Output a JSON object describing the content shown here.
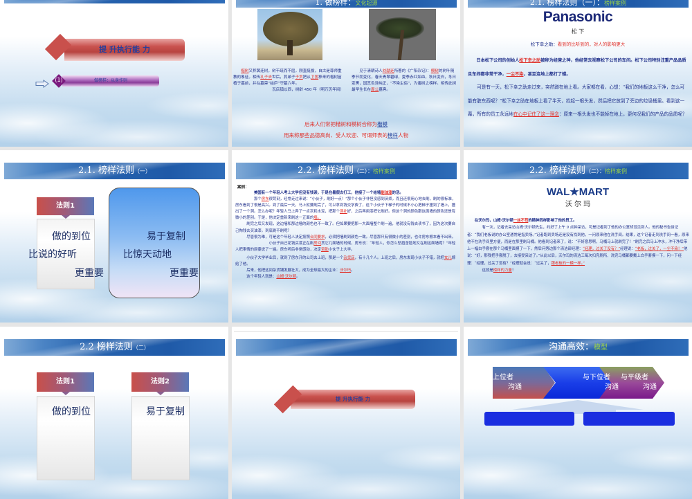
{
  "slides": [
    {
      "title_main": "提 升执行能 力",
      "sub_num": "(1)",
      "sub_label": "做榜样：以身作则"
    },
    {
      "header": "1. 做榜样：",
      "header_sub": "文化起源",
      "left_paragraph": [
        [
          "楷树",
          1
        ],
        [
          "又称黄连树，树干疏而不屈，刚直挺拔，自古是尊师重教的象征。相传",
          0
        ],
        [
          "孔子去",
          1
        ],
        [
          "世后，其弟子",
          0
        ],
        [
          "子贡",
          1
        ],
        [
          "把从",
          0
        ],
        [
          "卫国",
          1
        ],
        [
          "移来的楷树苗植于墓前，并在墓旁“结庐”守墓六年。",
          0
        ]
      ],
      "left_caption": "瓦店镇以西，树龄 450 年（明万历年间）",
      "right_paragraph": [
        [
          "见于清朝诗人",
          0
        ],
        [
          "刘献廷",
          1
        ],
        [
          "所著的《广阳杂记》：",
          0
        ],
        [
          "模树",
          1
        ],
        [
          "的树叶随季节而变化，春天青翠碧绿，夏季赤红如血，秋日变白，冬日变黑，因其色泽纯正，“不染尘俗”，为诸树之榜样。相传此树最早生长在",
          0
        ],
        [
          "周公",
          1
        ],
        [
          "墓旁。",
          0
        ]
      ],
      "conclusion1_a": "后来人们常把楷树和模树合称为",
      "conclusion1_b": "楷模",
      "conclusion2_a": "用来称那些品德高尚、受人欢迎、可谓师表的",
      "conclusion2_b": "榜样",
      "conclusion2_c": "人物"
    },
    {
      "header": "2.1. 榜样法则（一）：",
      "header_sub": "榜样案例",
      "logo": "Panasonic",
      "logo_cn": "松 下",
      "quote_name": "松下幸之助：",
      "quote": "看到的比听到的，对人的影响更大",
      "paragraphs": [
        [
          [
            "日本松下公司的创始人",
            0
          ],
          [
            "松下幸之助",
            1
          ],
          [
            "被称为经营之神，他经常去视察松下公司的车间。松下公司特别注重产品品质且车间都非常干净，",
            0
          ],
          [
            "一尘不染",
            1
          ],
          [
            "，甚至连地上都打了蜡。",
            0
          ]
        ],
        [
          [
            "可是有一天，松下幸之助走过来，突然蹲在地上看。大家都在看，心想：“我们的地板这么干净，怎么可能有脏东西呢？”松下幸之助在地板上看了半天，捡起一根头发，然后把它放到了旁边的垃圾桶里。看到这一幕，所有的员工永远地",
            0
          ],
          [
            "在心中记住了这一理念",
            1
          ],
          [
            "：原来一根头发也不能掉在地上，更何况我们的产品的品质呢？",
            0
          ]
        ]
      ]
    },
    {
      "header": "2.1. 榜样法则",
      "header_small": "（一）",
      "rule_label": "法则1",
      "left_lines": [
        "做的到位",
        "比说的好听",
        "更重要"
      ],
      "right_lines": [
        "易于复制",
        "比惊天动地",
        "更重要"
      ]
    },
    {
      "header": "2.2. 榜样法则",
      "header_small": "（二）：",
      "header_sub": "榜样案例",
      "case_label": "案例：",
      "paragraphs": [
        [
          [
            "美国有一个年轻人考上大学但没有钱读，于是在暑假去打工，他接了一个给墙",
            0
          ],
          [
            "刷油漆",
            1
          ],
          [
            "的活。",
            0
          ]
        ],
        [
          [
            "那个",
            0
          ],
          [
            "房东",
            1
          ],
          [
            "很苛刻，经常走过来说：“小伙子，刷好一点！”那个小伙子非但没感到厌烦，而且还很用心地去刷，刷的很标准，房东看到了很是高兴。到了最后一天，马上就要刷完了，可以拿到钱交学费了，这个小伙子下梯子的时候不小心把梯子撞到了墙上，撞出了一个洞。怎么办呢？年轻人马上弄了一点灰和水泥，把那个",
            0
          ],
          [
            "洞补",
            1
          ],
          [
            "好，之后再用漆把它刷好。但这个洞的颜色跟这面墙的颜色还是有微小的差别。于是，他决定重新来刷这一正面的",
            0
          ],
          [
            "墙。",
            1
          ]
        ],
        [
          [
            "刷完之后又发现，这边墙和那边墙的颜色也不一致了。但如果要把那一大面墙整个刷一遍，他就没有钱去读书了，因为这次要自己掏钱去买油漆。到底刷不刷呢？",
            0
          ]
        ],
        [
          [
            "尽管很为难，可是这个年轻人决定按照",
            0
          ],
          [
            "合同要求",
            1
          ],
          [
            "，必须把墙刷到颜色一致。尽管那只有很微小的差别，也许房东根本看不出来。",
            0
          ]
        ],
        [
          [
            "小伙子自己花钱买漆正在刷",
            0
          ],
          [
            "房间",
            1
          ],
          [
            "其它几面墙的时候，房东说：“年轻人，你怎么愁眉苦脸地又在刷这面墙呢？”年轻人把事情的原委说了一遍。房东听后非常感动，决定",
            0
          ],
          [
            "资助",
            1
          ],
          [
            "小伙子上大学。",
            0
          ]
        ],
        [
          [
            "小伙子大学毕业后，就到了房东开的公司去上班，那是一个",
            0
          ],
          [
            "杂货店",
            1
          ],
          [
            "，有十几个人。上班之后，房东发现小伙子不错，就把",
            0
          ],
          [
            "女儿",
            1
          ],
          [
            "嫁给了他。",
            0
          ]
        ],
        [
          [
            "后来，他把这间杂货铺发展壮大，成为全球最大的企业：",
            0
          ],
          [
            "沃尔玛",
            1
          ],
          [
            "。",
            0
          ]
        ],
        [
          [
            "这个年轻人就是：",
            0
          ],
          [
            "山姆·沃尔顿",
            1
          ],
          [
            "。",
            0
          ]
        ]
      ]
    },
    {
      "header": "2.2. 榜样法则",
      "header_small": "（二）：",
      "header_sub": "榜样案例",
      "logo": "WAL★MART",
      "logo_cn": "沃 尔 玛",
      "paragraphs": [
        [
          [
            "在沃尔玛，山姆·沃尔顿",
            0
          ],
          [
            "一丝不苟",
            1
          ],
          [
            "的精神同样影响了他的员工。",
            0
          ]
        ],
        [
          [
            "有一次，记者去采访山姆·沃尔顿先生，约好了上午 9 点钟采访，可是记者到了他的办公室却没见到人。他的秘书告诉记者：“我们老板说的办公室通常是指卖场。”记者跑到卖场还是没有找到他，一问原来他在洗手间。结果，这个记者走到洗手间一看，原来他不在洗手间里方便，而是在那里刷马桶。他看到记者来了，说：“不好意思啊，马桶马上就刷完了！”刷完之后马上冲水，冲干净后带上一幅白手套在那个马桶里面摸了一下，然后问旁边那个清洁部经理：",
            0
          ],
          [
            "“经理，过关了没有？”",
            1
          ],
          [
            "经理说：",
            0
          ],
          [
            "“老板，过关了，一尘不染！”",
            1
          ],
          [
            "他说：“好，那我把手套脱了，去接受采访了。”从此以后，沃尔玛的清洁工每次扫完厕所、洗完马桶都要戴上白手套摸一下，问一下经理：“经理，过关了没有？”经理就会说：“过关了，",
            0
          ],
          [
            "跟老板的一模一样。”",
            1
          ]
        ],
        [
          [
            "这就是",
            0
          ],
          [
            "榜样的力量",
            1
          ],
          [
            "！",
            0
          ]
        ]
      ]
    },
    {
      "header": "2.2 榜样法则",
      "header_small": "（二）",
      "rule1_label": "法则1",
      "rule2_label": "法则2",
      "rule1_text": "做的到位",
      "rule2_text": "易于复制"
    },
    {
      "title_main": "提 升执行能 力"
    },
    {
      "header": "沟通高效：",
      "header_sub": "模型",
      "chevrons": [
        {
          "l1": "上位者",
          "l2": "沟通"
        },
        {
          "l1": "与下位者",
          "l2": "沟通"
        },
        {
          "l1": "与平级者",
          "l2": "沟通"
        }
      ]
    }
  ]
}
